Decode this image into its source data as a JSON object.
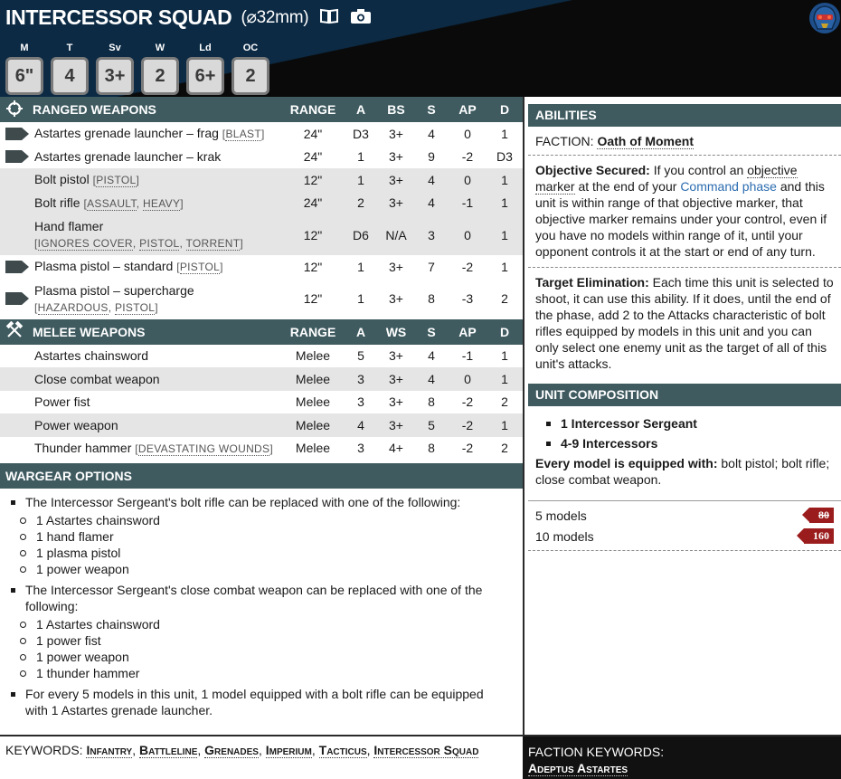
{
  "header": {
    "title": "INTERCESSOR SQUAD",
    "base": "(⌀32mm)",
    "stats": [
      {
        "label": "M",
        "value": "6\""
      },
      {
        "label": "T",
        "value": "4"
      },
      {
        "label": "Sv",
        "value": "3+"
      },
      {
        "label": "W",
        "value": "2"
      },
      {
        "label": "Ld",
        "value": "6+"
      },
      {
        "label": "OC",
        "value": "2"
      }
    ]
  },
  "ranged": {
    "title": "RANGED WEAPONS",
    "cols": [
      "RANGE",
      "A",
      "BS",
      "S",
      "AP",
      "D"
    ],
    "rows": [
      {
        "name": "Astartes grenade launcher – frag",
        "kw": [
          "BLAST"
        ],
        "range": "24\"",
        "a": "D3",
        "bs": "3+",
        "s": "4",
        "ap": "0",
        "d": "1"
      },
      {
        "name": "Astartes grenade launcher – krak",
        "kw": [],
        "range": "24\"",
        "a": "1",
        "bs": "3+",
        "s": "9",
        "ap": "-2",
        "d": "D3"
      },
      {
        "name": "Bolt pistol",
        "kw": [
          "PISTOL"
        ],
        "range": "12\"",
        "a": "1",
        "bs": "3+",
        "s": "4",
        "ap": "0",
        "d": "1"
      },
      {
        "name": "Bolt rifle",
        "kw": [
          "ASSAULT",
          "HEAVY"
        ],
        "range": "24\"",
        "a": "2",
        "bs": "3+",
        "s": "4",
        "ap": "-1",
        "d": "1"
      },
      {
        "name": "Hand flamer",
        "kw": [
          "IGNORES COVER",
          "PISTOL",
          "TORRENT"
        ],
        "range": "12\"",
        "a": "D6",
        "bs": "N/A",
        "s": "3",
        "ap": "0",
        "d": "1"
      },
      {
        "name": "Plasma pistol – standard",
        "kw": [
          "PISTOL"
        ],
        "range": "12\"",
        "a": "1",
        "bs": "3+",
        "s": "7",
        "ap": "-2",
        "d": "1"
      },
      {
        "name": "Plasma pistol – supercharge",
        "kw": [
          "HAZARDOUS",
          "PISTOL"
        ],
        "range": "12\"",
        "a": "1",
        "bs": "3+",
        "s": "8",
        "ap": "-3",
        "d": "2"
      }
    ]
  },
  "melee": {
    "title": "MELEE WEAPONS",
    "cols": [
      "RANGE",
      "A",
      "WS",
      "S",
      "AP",
      "D"
    ],
    "rows": [
      {
        "name": "Astartes chainsword",
        "kw": [],
        "range": "Melee",
        "a": "5",
        "bs": "3+",
        "s": "4",
        "ap": "-1",
        "d": "1"
      },
      {
        "name": "Close combat weapon",
        "kw": [],
        "range": "Melee",
        "a": "3",
        "bs": "3+",
        "s": "4",
        "ap": "0",
        "d": "1"
      },
      {
        "name": "Power fist",
        "kw": [],
        "range": "Melee",
        "a": "3",
        "bs": "3+",
        "s": "8",
        "ap": "-2",
        "d": "2"
      },
      {
        "name": "Power weapon",
        "kw": [],
        "range": "Melee",
        "a": "4",
        "bs": "3+",
        "s": "5",
        "ap": "-2",
        "d": "1"
      },
      {
        "name": "Thunder hammer",
        "kw": [
          "DEVASTATING WOUNDS"
        ],
        "range": "Melee",
        "a": "3",
        "bs": "4+",
        "s": "8",
        "ap": "-2",
        "d": "2"
      }
    ]
  },
  "wargear": {
    "title": "WARGEAR OPTIONS",
    "opt1": "The Intercessor Sergeant's bolt rifle can be replaced with one of the following:",
    "opt1_items": [
      "1 Astartes chainsword",
      "1 hand flamer",
      "1 plasma pistol",
      "1 power weapon"
    ],
    "opt2": "The Intercessor Sergeant's close combat weapon can be replaced with one of the following:",
    "opt2_items": [
      "1 Astartes chainsword",
      "1 power fist",
      "1 power weapon",
      "1 thunder hammer"
    ],
    "opt3": "For every 5 models in this unit, 1 model equipped with a bolt rifle can be equipped with 1 Astartes grenade launcher."
  },
  "abilities": {
    "title": "ABILITIES",
    "faction_label": "FACTION:",
    "faction_value": "Oath of Moment",
    "obj_title": "Objective Secured:",
    "obj_t1": "If you control an",
    "obj_t2": "objective marker",
    "obj_t3": "at the end of your",
    "obj_t4": "Command phase",
    "obj_t5": "and this unit is within range of that objective marker, that objective marker remains under your control, even if you have no models within range of it, until your opponent controls it at the start or end of any turn.",
    "target_title": "Target Elimination:",
    "target_text": "Each time this unit is selected to shoot, it can use this ability. If it does, until the end of the phase, add 2 to the Attacks characteristic of bolt rifles equipped by models in this unit and you can only select one enemy unit as the target of all of this unit's attacks."
  },
  "composition": {
    "title": "UNIT COMPOSITION",
    "items": [
      "1 Intercessor Sergeant",
      "4-9 Intercessors"
    ],
    "equipped_label": "Every model is equipped with:",
    "equipped_text": "bolt pistol; bolt rifle; close combat weapon."
  },
  "points": [
    {
      "label": "5 models",
      "value": "80"
    },
    {
      "label": "10 models",
      "value": "160"
    }
  ],
  "keywords": {
    "label": "KEYWORDS:",
    "items": [
      "Infantry",
      "Battleline",
      "Grenades",
      "Imperium",
      "Tacticus",
      "Intercessor Squad"
    ],
    "faction_label": "FACTION KEYWORDS:",
    "faction_value": "Adeptus Astartes"
  },
  "colors": {
    "section_header": "#3f5b60",
    "header_bg": "#0c2a44",
    "points_tag": "#9b1c1c",
    "link": "#2b6cb0"
  }
}
